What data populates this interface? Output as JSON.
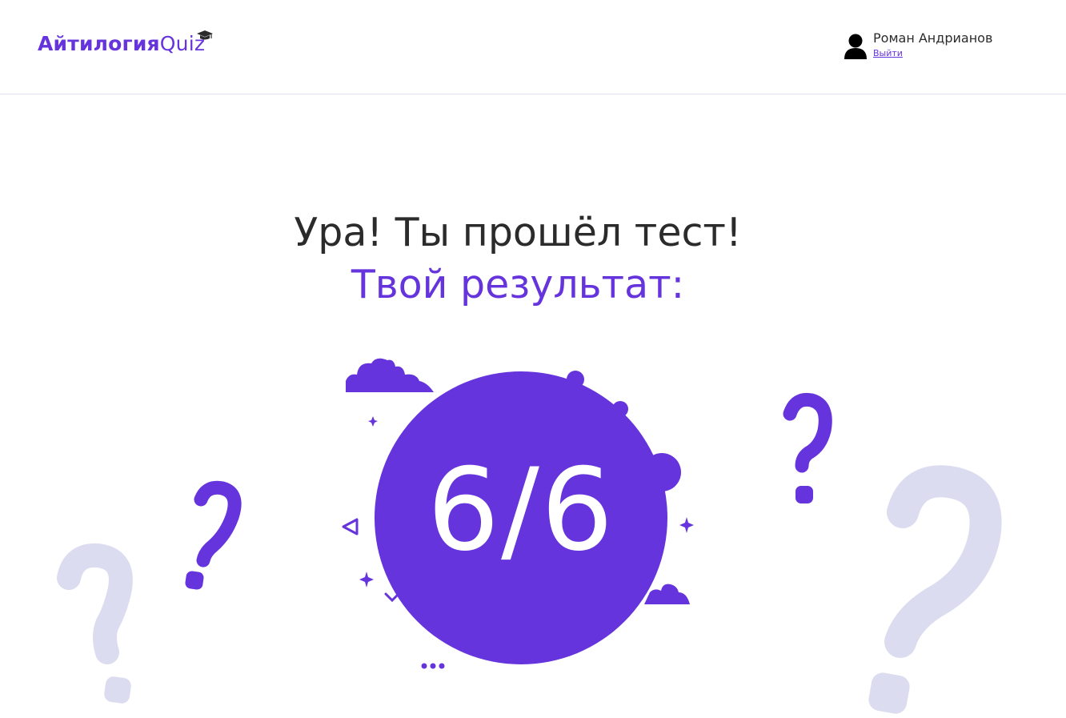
{
  "header": {
    "logo_main": "Айтилогия",
    "logo_quiz": "Quiz",
    "user_name": "Роман Андрианов",
    "logout_label": "Выйти"
  },
  "result": {
    "title": "Ура! Ты прошёл тест!",
    "subtitle": "Твой результат:",
    "score": "6/6"
  },
  "colors": {
    "accent": "#6634dc",
    "text": "#2b2b2b",
    "decor_light": "#dcdcf0"
  },
  "icons": {
    "logo_cap": "graduation-cap-icon",
    "avatar": "user-avatar-icon"
  }
}
